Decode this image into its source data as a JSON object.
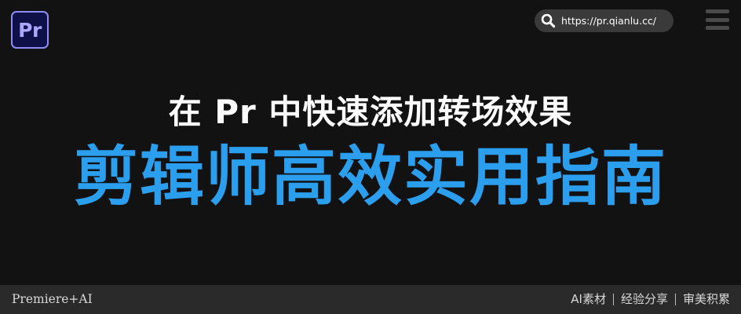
{
  "logo": {
    "text": "Pr",
    "accent": "#8d8cf5",
    "background": "#101049"
  },
  "url_bar": {
    "url": "https://pr.qianlu.cc/",
    "icon": "search-icon"
  },
  "menu": {
    "icon": "hamburger-menu-icon"
  },
  "title": "在 Pr 中快速添加转场效果",
  "headline": "剪辑师高效实用指南",
  "footer": {
    "left": "Premiere+AI",
    "tags": [
      "AI素材",
      "经验分享",
      "审美积累"
    ]
  },
  "colors": {
    "background": "#121212",
    "headline": "#2b9eed",
    "title": "#ffffff",
    "footer_bar": "#2a2a2a"
  }
}
